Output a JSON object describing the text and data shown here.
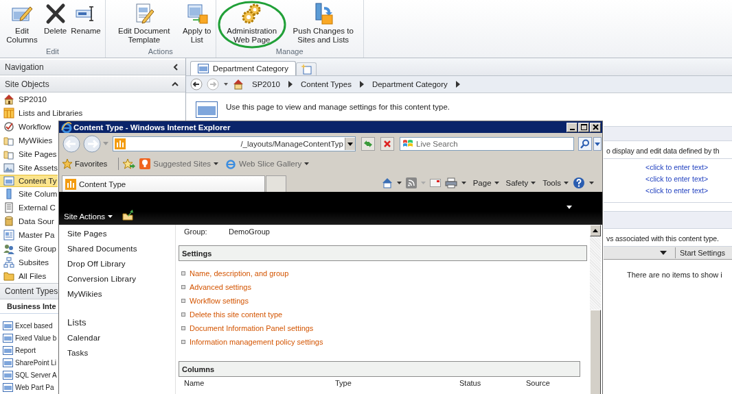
{
  "ribbon": {
    "groups": [
      {
        "label": "Edit",
        "buttons": [
          {
            "label": "Edit Columns",
            "highlighted": false
          },
          {
            "label": "Delete",
            "highlighted": false
          },
          {
            "label": "Rename",
            "highlighted": false
          }
        ]
      },
      {
        "label": "Actions",
        "buttons": [
          {
            "label": "Edit Document Template",
            "highlighted": false
          },
          {
            "label": "Apply to List",
            "highlighted": false
          }
        ]
      },
      {
        "label": "Manage",
        "buttons": [
          {
            "label": "Administration Web Page",
            "highlighted": true
          },
          {
            "label": "Push Changes to Sites and Lists",
            "highlighted": false
          }
        ]
      }
    ]
  },
  "navigation": {
    "title": "Navigation"
  },
  "site_objects": {
    "title": "Site Objects",
    "items": [
      {
        "label": "SP2010",
        "selected": false
      },
      {
        "label": "Lists and Libraries",
        "selected": false
      },
      {
        "label": "Workflow",
        "selected": false
      },
      {
        "label": "MyWikies",
        "selected": false
      },
      {
        "label": "Site Pages",
        "selected": false
      },
      {
        "label": "Site Assets",
        "selected": false
      },
      {
        "label": "Content Ty",
        "selected": true
      },
      {
        "label": "Site Colum",
        "selected": false
      },
      {
        "label": "External C",
        "selected": false
      },
      {
        "label": "Data Sour",
        "selected": false
      },
      {
        "label": "Master Pa",
        "selected": false
      },
      {
        "label": "Site Group",
        "selected": false
      },
      {
        "label": "Subsites",
        "selected": false
      },
      {
        "label": "All Files",
        "selected": false
      }
    ]
  },
  "content_types": {
    "title": "Content Types",
    "group": "Business Inte",
    "items": [
      "Excel based",
      "Fixed Value b",
      "Report",
      "SharePoint Li",
      "SQL Server A",
      "Web Part Pa"
    ]
  },
  "tabs": [
    {
      "label": "Department Category",
      "selected": true
    }
  ],
  "breadcrumb": [
    "SP2010",
    "Content Types",
    "Department Category"
  ],
  "description": "Use this page to view and manage settings for this content type.",
  "background_page": {
    "section_text": "o display and edit data defined by th",
    "links": [
      "<click to enter text>",
      "<click to enter text>",
      "<click to enter text>"
    ],
    "workflow_text": "vs associated with this content type.",
    "column_header": "Start Settings",
    "empty_text": "There are no items to show i"
  },
  "browser": {
    "title": "Content Type - Windows Internet Explorer",
    "address": "/_layouts/ManageContentTyp",
    "search_placeholder": "Live Search",
    "favorites": "Favorites",
    "favorite_links": [
      "Suggested Sites",
      "Web Slice Gallery"
    ],
    "tab": "Content Type",
    "commands": [
      "Page",
      "Safety",
      "Tools"
    ],
    "site_actions": "Site Actions",
    "quick_launch": [
      {
        "label": "Site Pages",
        "kind": "link"
      },
      {
        "label": "Shared Documents",
        "kind": "link"
      },
      {
        "label": "Drop Off Library",
        "kind": "link"
      },
      {
        "label": "Conversion Library",
        "kind": "link"
      },
      {
        "label": "MyWikies",
        "kind": "link"
      },
      {
        "label": "Lists",
        "kind": "heading"
      },
      {
        "label": "Calendar",
        "kind": "link"
      },
      {
        "label": "Tasks",
        "kind": "link"
      }
    ],
    "group_label": "Group:",
    "group_value": "DemoGroup",
    "settings_title": "Settings",
    "settings_links": [
      "Name, description, and group",
      "Advanced settings",
      "Workflow settings",
      "Delete this site content type",
      "Document Information Panel settings",
      "Information management policy settings"
    ],
    "columns_title": "Columns",
    "column_headers": [
      "Name",
      "Type",
      "Status",
      "Source"
    ]
  }
}
